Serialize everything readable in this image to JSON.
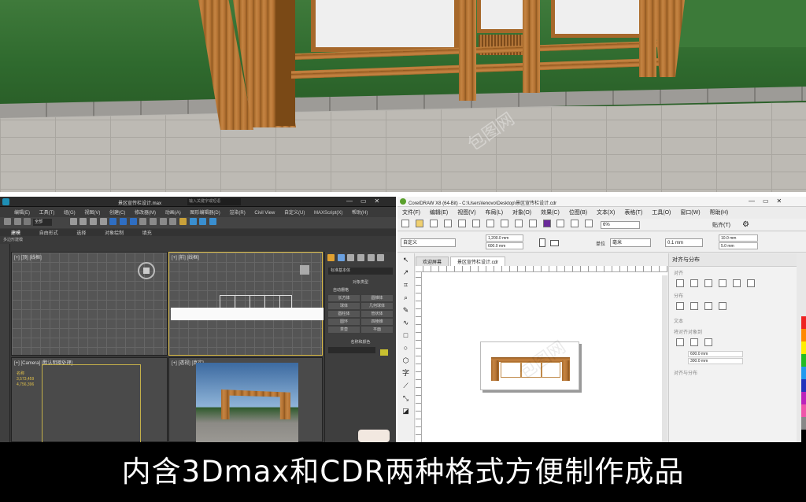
{
  "caption": "内含3Dmax和CDR两种格式方便制作成品",
  "max": {
    "title": "景区宣传栏设计.max",
    "search_placeholder": "输入关键字或短语",
    "menu": [
      "编辑(E)",
      "工具(T)",
      "组(G)",
      "视图(V)",
      "创建(C)",
      "修改器(M)",
      "动画(A)",
      "图形编辑器(D)",
      "渲染(R)",
      "Civil View",
      "自定义(U)",
      "MAXScript(X)",
      "帮助(H)"
    ],
    "ribbon_tabs": [
      "建模",
      "自由形式",
      "选择",
      "对象绘制",
      "填充"
    ],
    "ribbon_sub": "多边形建模",
    "selection_dropdown": "全部",
    "viewport_labels": [
      "[+] [顶] [线框]",
      "[+] [前] [线框]",
      "[+] [Camera] [默认明暗处理]",
      "[+] [透视] [真实]"
    ],
    "side_panel": {
      "dropdown": "标准基本体",
      "rollout_title": "对象类型",
      "autogrid": "自动栅格",
      "buttons": [
        "长方体",
        "圆锥体",
        "球体",
        "几何球体",
        "圆柱体",
        "管状体",
        "圆环",
        "四棱锥",
        "茶壶",
        "平面"
      ],
      "name_rollout": "名称和颜色"
    },
    "camera_text": [
      "名称",
      "3,573,459",
      "4,756,396"
    ]
  },
  "cdr": {
    "title": "CorelDRAW X8 (64-Bit) - C:\\Users\\lenovo\\Desktop\\景区宣传栏设计.cdr",
    "menu": [
      "文件(F)",
      "编辑(E)",
      "视图(V)",
      "布局(L)",
      "对象(O)",
      "效果(C)",
      "位图(B)",
      "文本(X)",
      "表格(T)",
      "工具(O)",
      "窗口(W)",
      "帮助(H)"
    ],
    "zoom": "6%",
    "snap_label": "贴齐(T)",
    "preset": "自定义",
    "width_value": "1,200.0 mm",
    "height_value": "600.0 mm",
    "unit_label": "单位",
    "unit_value": "毫米",
    "nudge": "0.1 mm",
    "dup_x": "10.0 mm",
    "dup_y": "5.0 mm",
    "tabs": [
      "欢迎屏幕",
      "景区宣传栏设计.cdr"
    ],
    "docker": {
      "title": "对齐与分布",
      "sections": [
        "对齐",
        "分布",
        "文本",
        "将对齐对象到",
        "对齐与分布"
      ],
      "x_value": "600.0 mm",
      "y_value": "300.0 mm"
    }
  }
}
